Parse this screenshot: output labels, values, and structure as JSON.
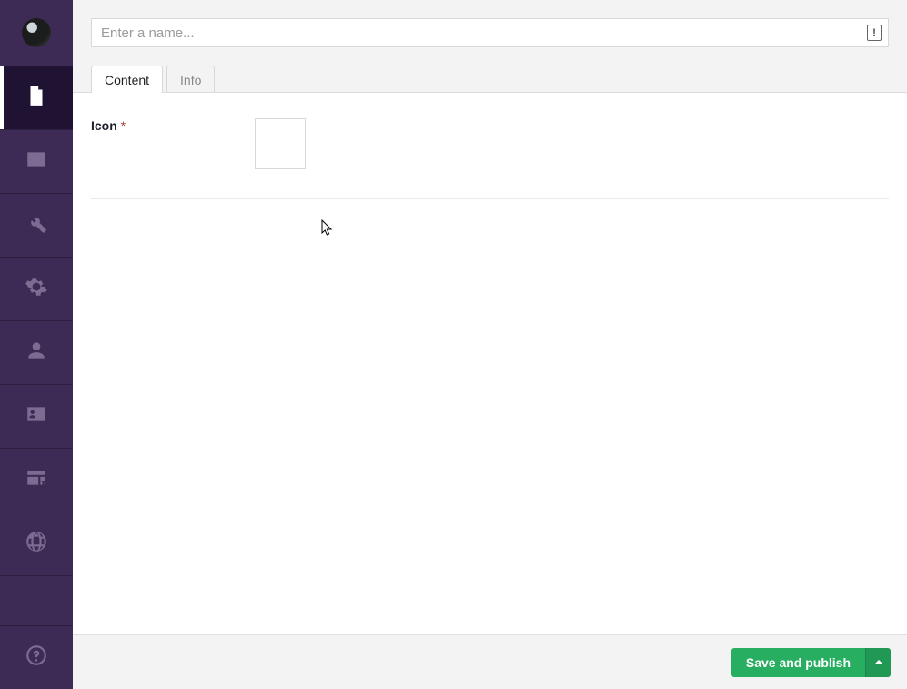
{
  "header": {
    "name_placeholder": "Enter a name...",
    "name_value": "",
    "status_icon_glyph": "!"
  },
  "tabs": [
    {
      "label": "Content",
      "active": true
    },
    {
      "label": "Info",
      "active": false
    }
  ],
  "fields": {
    "icon": {
      "label": "Icon",
      "required_marker": "*"
    }
  },
  "footer": {
    "publish_label": "Save and publish"
  },
  "sidebar": {
    "items": [
      {
        "name": "content-icon",
        "active": true
      },
      {
        "name": "media-icon",
        "active": false
      },
      {
        "name": "settings-wrench-icon",
        "active": false
      },
      {
        "name": "gear-icon",
        "active": false
      },
      {
        "name": "users-icon",
        "active": false
      },
      {
        "name": "members-card-icon",
        "active": false
      },
      {
        "name": "forms-icon",
        "active": false
      },
      {
        "name": "globe-icon",
        "active": false
      }
    ],
    "help": {
      "name": "help-icon"
    }
  }
}
